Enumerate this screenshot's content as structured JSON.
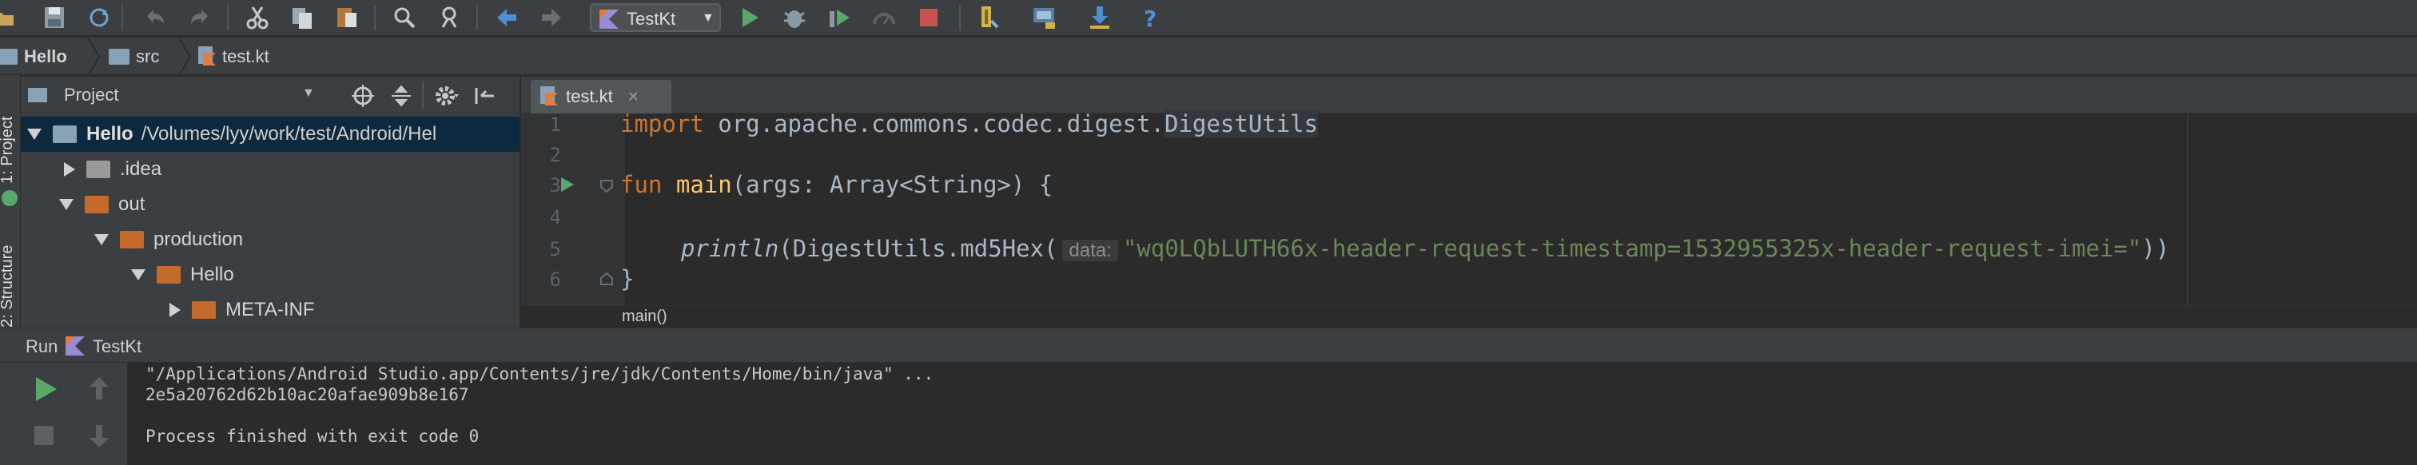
{
  "toolbar": {
    "icons": [
      "open-icon",
      "save-icon",
      "sync-icon",
      "undo-icon",
      "redo-icon",
      "cut-icon",
      "copy-icon",
      "paste-icon",
      "find-icon",
      "replace-icon",
      "back-icon",
      "forward-icon",
      "run-icon",
      "debug-icon",
      "coverage-icon",
      "profile-icon",
      "stop-icon",
      "sdk-manager-icon",
      "project-structure-icon",
      "download-icon",
      "help-icon"
    ],
    "run_config": "TestKt"
  },
  "navbar": {
    "crumbs": [
      "Hello",
      "src",
      "test.kt"
    ]
  },
  "side_strip": {
    "project_label": "1: Project",
    "structure_label": "2: Structure"
  },
  "project_panel": {
    "title": "Project",
    "tree": [
      {
        "label": "Hello",
        "path": "/Volumes/lyy/work/test/Android/Hel"
      },
      {
        "label": ".idea"
      },
      {
        "label": "out"
      },
      {
        "label": "production"
      },
      {
        "label": "Hello"
      },
      {
        "label": "META-INF"
      }
    ]
  },
  "editor": {
    "tab": "test.kt",
    "line_numbers": [
      "1",
      "2",
      "3",
      "4",
      "5",
      "6"
    ],
    "line1": {
      "kw": "import",
      "pkg": "org.apache.commons.codec.digest.",
      "cls": "DigestUtils"
    },
    "line3": {
      "kw": "fun",
      "name": "main",
      "params": "(args: Array<String>) {"
    },
    "line5": {
      "call": "println",
      "obj": "(DigestUtils.md5Hex(",
      "hint": "data:",
      "str": "\"wq0LQbLUTH66x-header-request-timestamp=1532955325x-header-request-imei=\"",
      "close": "))"
    },
    "line6": "}",
    "breadcrumb": "main()"
  },
  "run_panel": {
    "run_label": "Run",
    "config": "TestKt",
    "lines": [
      "\"/Applications/Android Studio.app/Contents/jre/jdk/Contents/Home/bin/java\" ...",
      "2e5a20762d62b10ac20afae909b8e167",
      "",
      "Process finished with exit code 0"
    ]
  },
  "colors": {
    "background": "#2b2b2b",
    "panel": "#3c3f41",
    "keyword": "#cc7832",
    "function": "#ffc66d",
    "string": "#6a8759",
    "run_green": "#59a869",
    "stop_red": "#c75450"
  }
}
